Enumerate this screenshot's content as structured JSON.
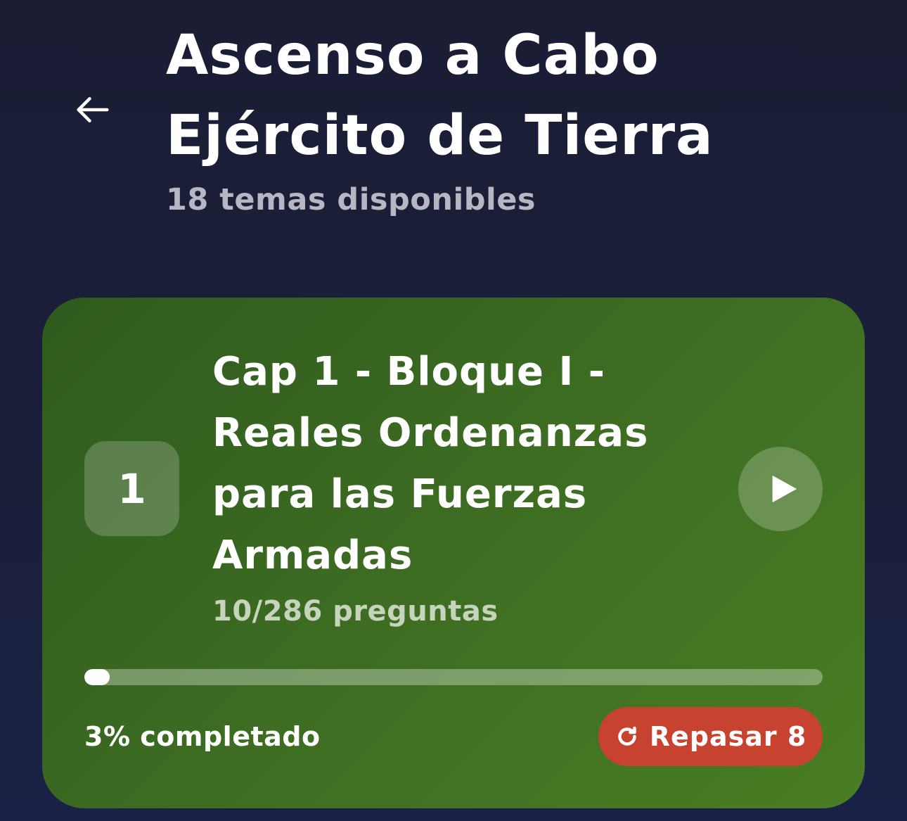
{
  "header": {
    "back_icon": "arrow-left-icon",
    "title_line1": "Ascenso a Cabo",
    "title_line2": "Ejército de Tierra",
    "subtitle": "18 temas disponibles"
  },
  "topics": [
    {
      "number": "1",
      "title": "Cap 1 - Bloque I - Reales Ordenanzas para las Fuerzas Armadas",
      "questions": "10/286 preguntas",
      "progress_fraction": 0.034,
      "progress_label": "3% completado",
      "play_icon": "play-icon",
      "review_icon": "refresh-icon",
      "review_label": "Repasar 8"
    }
  ],
  "colors": {
    "background": "#1a1d34",
    "card_green": "#3c6b22",
    "review_red": "#c8432f",
    "subtitle_gray": "#b6b7c2"
  }
}
